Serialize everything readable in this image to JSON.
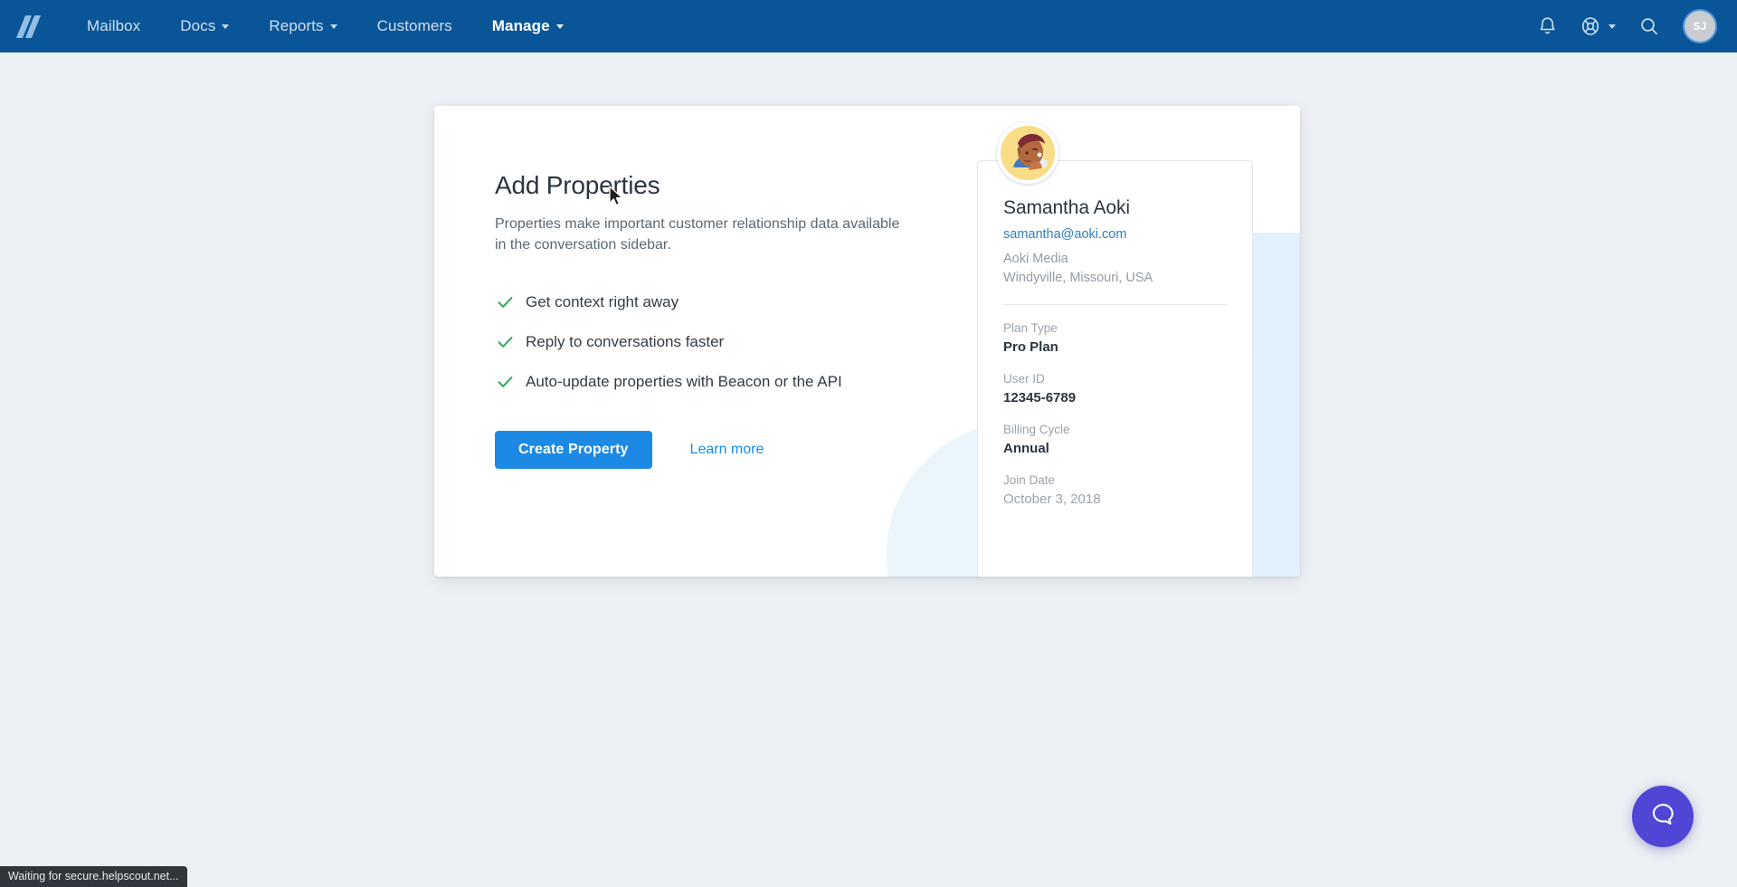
{
  "navbar": {
    "logo_name": "helpscout-logo",
    "items": [
      {
        "label": "Mailbox",
        "has_caret": false,
        "active": false
      },
      {
        "label": "Docs",
        "has_caret": true,
        "active": false
      },
      {
        "label": "Reports",
        "has_caret": true,
        "active": false
      },
      {
        "label": "Customers",
        "has_caret": false,
        "active": false
      },
      {
        "label": "Manage",
        "has_caret": true,
        "active": true
      }
    ],
    "icons": [
      "bell-icon",
      "lifesaver-icon",
      "search-icon"
    ],
    "avatar_initials": "SJ",
    "background_color": "#0a5597"
  },
  "card": {
    "title": "Add Properties",
    "subtitle": "Properties make important customer relationship data available in the conversation sidebar.",
    "features": [
      "Get context right away",
      "Reply to conversations faster",
      "Auto-update properties with Beacon or the API"
    ],
    "primary_button": "Create Property",
    "secondary_link": "Learn more",
    "accent_color": "#1c8ae4",
    "check_color": "#3cab63"
  },
  "profile": {
    "name": "Samantha Aoki",
    "email": "samantha@aoki.com",
    "company": "Aoki Media",
    "location": "Windyville, Missouri, USA",
    "properties": [
      {
        "label": "Plan Type",
        "value": "Pro Plan"
      },
      {
        "label": "User ID",
        "value": "12345-6789"
      },
      {
        "label": "Billing Cycle",
        "value": "Annual"
      },
      {
        "label": "Join Date",
        "value": "October 3, 2018"
      }
    ]
  },
  "beacon": {
    "icon": "chat-bubble-icon",
    "color": "#4f46d6"
  },
  "statusbar": {
    "text": "Waiting for secure.helpscout.net..."
  }
}
